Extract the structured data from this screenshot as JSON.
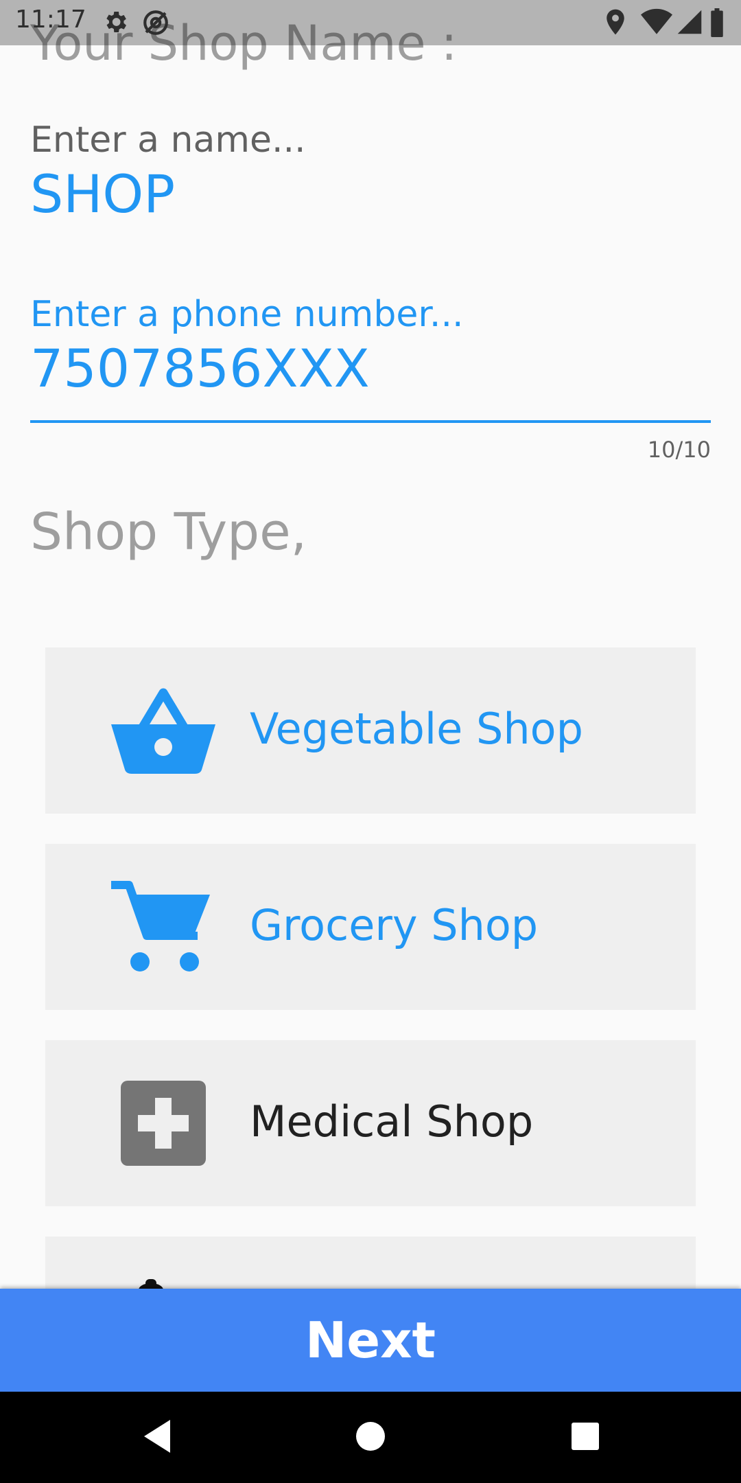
{
  "status_bar": {
    "time": "11:17",
    "icons": [
      "gear-icon",
      "at-icon",
      "location-icon",
      "wifi-icon",
      "signal-icon",
      "battery-icon"
    ]
  },
  "form": {
    "title": "Your Shop Name :",
    "name_field": {
      "label": "Enter a name...",
      "value": "SHOP"
    },
    "phone_field": {
      "label": "Enter a phone number...",
      "value": "7507856XXX",
      "counter": "10/10"
    }
  },
  "shop_type": {
    "title": "Shop Type,",
    "options": [
      {
        "label": "Vegetable Shop",
        "icon": "basket-icon",
        "selected": true
      },
      {
        "label": "Grocery Shop",
        "icon": "cart-icon",
        "selected": true
      },
      {
        "label": "Medical Shop",
        "icon": "medical-cross-icon",
        "selected": false
      },
      {
        "label": "",
        "icon": "partial-icon",
        "selected": false
      }
    ]
  },
  "actions": {
    "next_label": "Next"
  },
  "colors": {
    "accent": "#2196f3",
    "button": "#4285f4",
    "muted": "#9e9e9e",
    "card": "#efefef",
    "unselected_icon": "#757575"
  },
  "nav": {
    "icons": [
      "back-icon",
      "home-icon",
      "recents-icon"
    ]
  }
}
